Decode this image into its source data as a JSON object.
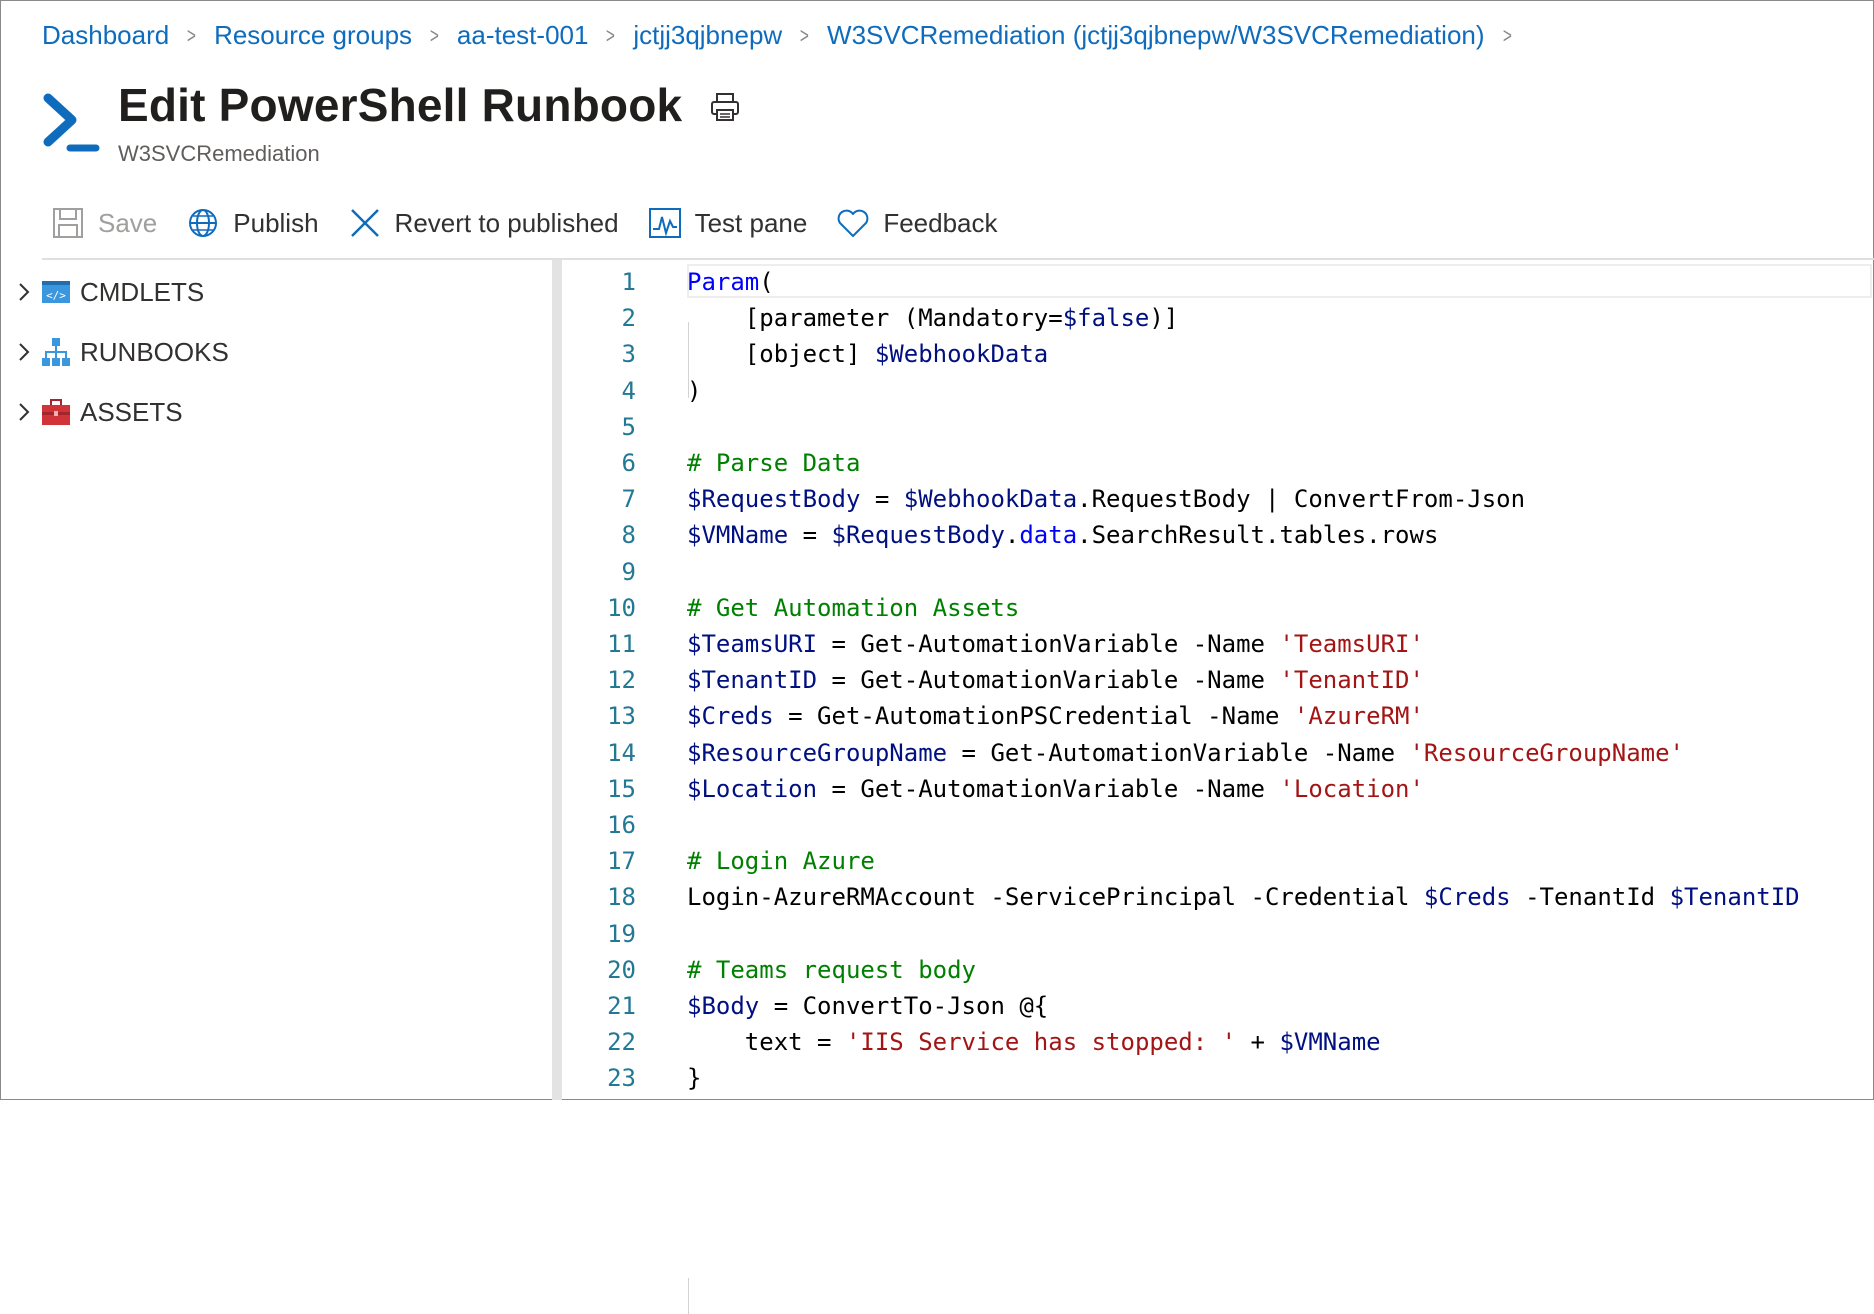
{
  "breadcrumb": [
    "Dashboard",
    "Resource groups",
    "aa-test-001",
    "jctjj3qjbnepw",
    "W3SVCRemediation (jctjj3qjbnepw/W3SVCRemediation)"
  ],
  "header": {
    "title": "Edit PowerShell Runbook",
    "subtitle": "W3SVCRemediation"
  },
  "toolbar": {
    "save": "Save",
    "publish": "Publish",
    "revert": "Revert to published",
    "test": "Test pane",
    "feedback": "Feedback"
  },
  "tree": [
    "CMDLETS",
    "RUNBOOKS",
    "ASSETS"
  ],
  "editor": {
    "line_numbers": [
      "1",
      "2",
      "3",
      "4",
      "5",
      "6",
      "7",
      "8",
      "9",
      "10",
      "11",
      "12",
      "13",
      "14",
      "15",
      "16",
      "17",
      "18",
      "19",
      "20",
      "21",
      "22",
      "23"
    ],
    "lines": [
      [
        {
          "t": "Param",
          "c": "kw"
        },
        {
          "t": "(",
          "c": ""
        }
      ],
      [
        {
          "t": "    [parameter (Mandatory=",
          "c": ""
        },
        {
          "t": "$false",
          "c": "var"
        },
        {
          "t": ")]",
          "c": ""
        }
      ],
      [
        {
          "t": "    [object] ",
          "c": ""
        },
        {
          "t": "$WebhookData",
          "c": "var"
        }
      ],
      [
        {
          "t": ")",
          "c": ""
        }
      ],
      [],
      [
        {
          "t": "# Parse Data",
          "c": "cm"
        }
      ],
      [
        {
          "t": "$RequestBody",
          "c": "var"
        },
        {
          "t": " = ",
          "c": ""
        },
        {
          "t": "$WebhookData",
          "c": "var"
        },
        {
          "t": ".RequestBody | ConvertFrom-Json",
          "c": ""
        }
      ],
      [
        {
          "t": "$VMName",
          "c": "var"
        },
        {
          "t": " = ",
          "c": ""
        },
        {
          "t": "$RequestBody",
          "c": "var"
        },
        {
          "t": ".",
          "c": ""
        },
        {
          "t": "data",
          "c": "var2"
        },
        {
          "t": ".SearchResult.tables.rows",
          "c": ""
        }
      ],
      [],
      [
        {
          "t": "# Get Automation Assets",
          "c": "cm"
        }
      ],
      [
        {
          "t": "$TeamsURI",
          "c": "var"
        },
        {
          "t": " = Get-AutomationVariable -Name ",
          "c": ""
        },
        {
          "t": "'TeamsURI'",
          "c": "str"
        }
      ],
      [
        {
          "t": "$TenantID",
          "c": "var"
        },
        {
          "t": " = Get-AutomationVariable -Name ",
          "c": ""
        },
        {
          "t": "'TenantID'",
          "c": "str"
        }
      ],
      [
        {
          "t": "$Creds",
          "c": "var"
        },
        {
          "t": " = Get-AutomationPSCredential -Name ",
          "c": ""
        },
        {
          "t": "'AzureRM'",
          "c": "str"
        }
      ],
      [
        {
          "t": "$ResourceGroupName",
          "c": "var"
        },
        {
          "t": " = Get-AutomationVariable -Name ",
          "c": ""
        },
        {
          "t": "'ResourceGroupName'",
          "c": "str"
        }
      ],
      [
        {
          "t": "$Location",
          "c": "var"
        },
        {
          "t": " = Get-AutomationVariable -Name ",
          "c": ""
        },
        {
          "t": "'Location'",
          "c": "str"
        }
      ],
      [],
      [
        {
          "t": "# Login Azure",
          "c": "cm"
        }
      ],
      [
        {
          "t": "Login-AzureRMAccount -ServicePrincipal -Credential ",
          "c": ""
        },
        {
          "t": "$Creds",
          "c": "var"
        },
        {
          "t": " -TenantId ",
          "c": ""
        },
        {
          "t": "$TenantID",
          "c": "var"
        }
      ],
      [],
      [
        {
          "t": "# Teams request body",
          "c": "cm"
        }
      ],
      [
        {
          "t": "$Body",
          "c": "var"
        },
        {
          "t": " = ConvertTo-Json @{",
          "c": ""
        }
      ],
      [
        {
          "t": "    text = ",
          "c": ""
        },
        {
          "t": "'IIS Service has stopped: '",
          "c": "str"
        },
        {
          "t": " + ",
          "c": ""
        },
        {
          "t": "$VMName",
          "c": "var"
        }
      ],
      [
        {
          "t": "}",
          "c": ""
        }
      ]
    ]
  }
}
